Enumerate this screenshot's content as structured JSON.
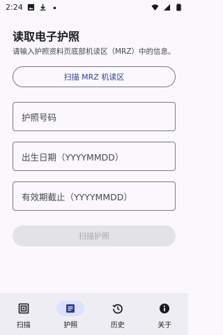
{
  "status_bar": {
    "time": "2:24",
    "left_icons": [
      "image-icon",
      "download-icon",
      "dot-icon"
    ],
    "right_icons": [
      "wifi-icon",
      "signal-icon",
      "battery-icon"
    ]
  },
  "page": {
    "title": "读取电子护照",
    "subtitle": "请输入护照资料页底部机读区（MRZ）中的信息。"
  },
  "scan_mrz_button": {
    "label": "扫描 MRZ 机读区"
  },
  "fields": {
    "passport_number": {
      "placeholder": "护照号码",
      "value": ""
    },
    "birth_date": {
      "placeholder": "出生日期（YYYYMMDD）",
      "value": ""
    },
    "expiry_date": {
      "placeholder": "有效期截止（YYYYMMDD）",
      "value": ""
    }
  },
  "scan_passport_button": {
    "label": "扫描护照",
    "enabled": false
  },
  "nav": {
    "items": [
      {
        "label": "扫描",
        "icon": "scan-icon",
        "active": false
      },
      {
        "label": "护照",
        "icon": "passport-icon",
        "active": true
      },
      {
        "label": "历史",
        "icon": "history-icon",
        "active": false
      },
      {
        "label": "关于",
        "icon": "info-icon",
        "active": false
      }
    ]
  },
  "colors": {
    "background": "#fbf8fd",
    "accent": "#2b3f93",
    "nav_active_pill": "#dde1ff",
    "disabled_button": "#e3e2e6"
  }
}
